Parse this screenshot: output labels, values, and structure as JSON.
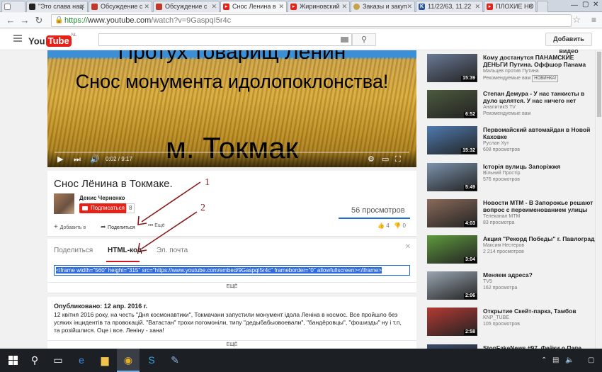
{
  "browser": {
    "tabs": [
      {
        "label": "",
        "icon": "doc"
      },
      {
        "label": "\"Это слава нац",
        "icon": "dark"
      },
      {
        "label": "Обсуждение с",
        "icon": "car"
      },
      {
        "label": "Обсуждение с",
        "icon": "car"
      },
      {
        "label": "Снос Ленина в",
        "icon": "youtube"
      },
      {
        "label": "Жириновский",
        "icon": "youtube"
      },
      {
        "label": "Заказы и закуп",
        "icon": "seal"
      },
      {
        "label": "11/22/63, 11.22",
        "icon": "k"
      },
      {
        "label": "ПЛОХИЕ НО",
        "icon": "youtube"
      }
    ],
    "url_scheme": "https://",
    "url_host": "www.youtube.com",
    "url_path": "/watch?v=9GaspqI5r4c"
  },
  "yt_header": {
    "logo_you": "You",
    "logo_tube": "Tube",
    "logo_region": "NL",
    "upload_label": "Добавить видео"
  },
  "player": {
    "banner_top": "Протух товарищ Ленин",
    "banner_mid": "Снос монумента идолопоклонства!",
    "banner_bottom": "м. Токмак",
    "time": "0:02 / 9:17"
  },
  "video": {
    "title": "Снос Лёнина в Токмаке.",
    "channel": "Денис Черненко",
    "subscribe_label": "Подписаться",
    "subscribers": "8",
    "views": "56 просмотров",
    "add_label": "Добавить в",
    "share_label": "Поделиться",
    "more_label": "Ещё",
    "likes": "4",
    "dislikes": "0"
  },
  "share": {
    "tabs": [
      "Поделиться",
      "HTML-код",
      "Эл. почта"
    ],
    "embed_code": "<iframe width=\"560\" height=\"315\" src=\"https://www.youtube.com/embed/9GaspqI5r4c\" frameborder=\"0\" allowfullscreen></iframe>",
    "more": "ЕЩЁ"
  },
  "description": {
    "published": "Опубликовано: 12 апр. 2016 г.",
    "text": "12 квітня 2016 року, на честь \"Дня космонавтики\", Токмачани запустили монумент ідола Леніна в космос. Все пройшло без усяких інцидентів та провокацій. \"Ватастан\" трохи погомоніли, типу \"дедыбабыовоевали\", \"бандёровцы\", \"фошизды\" ну і т.п, та розійшлися. Оце і все. Леніну - хана!",
    "more": "ЕЩЁ"
  },
  "related": [
    {
      "title": "Кому достанутся ПАНАМСКИЕ ДЕНЬГИ Путина. Оффшор Панама",
      "channel": "Мальцев против Путина",
      "meta": "Рекомендуемые вам",
      "badge": "НОВИНКА!",
      "duration": "15:39",
      "color": "#6b7a96"
    },
    {
      "title": "Степан Демура - У нас танкисты в дуло целятся. У нас ничего нет",
      "channel": "АналитикS TV",
      "meta": "Рекомендуемые вам",
      "badge": "",
      "duration": "6:52",
      "color": "#4d5a3e"
    },
    {
      "title": "Первомайский автомайдан в Новой Каховке",
      "channel": "Руслан Хут",
      "meta": "608 просмотров",
      "badge": "",
      "duration": "15:32",
      "color": "#4f7bb0"
    },
    {
      "title": "Історія вулиць Запоріжжя",
      "channel": "Вільний Простір",
      "meta": "576 просмотров",
      "badge": "",
      "duration": "5:49",
      "color": "#7c93ad"
    },
    {
      "title": "Новости МТМ - В Запорожье решают вопрос с переименованием улицы",
      "channel": "Телеканал МТМ",
      "meta": "83 просмотра",
      "badge": "",
      "duration": "4:03",
      "color": "#8a6a5a"
    },
    {
      "title": "Акция \"Рекорд Победы\" г. Павлоград",
      "channel": "Максим Нестеров",
      "meta": "2 214 просмотров",
      "badge": "",
      "duration": "3:04",
      "color": "#5f9a3e"
    },
    {
      "title": "Меняем адреса?",
      "channel": "TV5",
      "meta": "162 просмотра",
      "badge": "",
      "duration": "2:06",
      "color": "#9aa6b2"
    },
    {
      "title": "Открытие Скейт-парка, Тамбов",
      "channel": "KNP_TUBE",
      "meta": "105 просмотров",
      "badge": "",
      "duration": "2:58",
      "color": "#b43a34"
    },
    {
      "title": "StopFakeNews #97. Фейки о Папе",
      "channel": "",
      "meta": "",
      "badge": "",
      "duration": "",
      "color": "#3a4a6a"
    }
  ],
  "annotations": [
    "1",
    "2"
  ]
}
